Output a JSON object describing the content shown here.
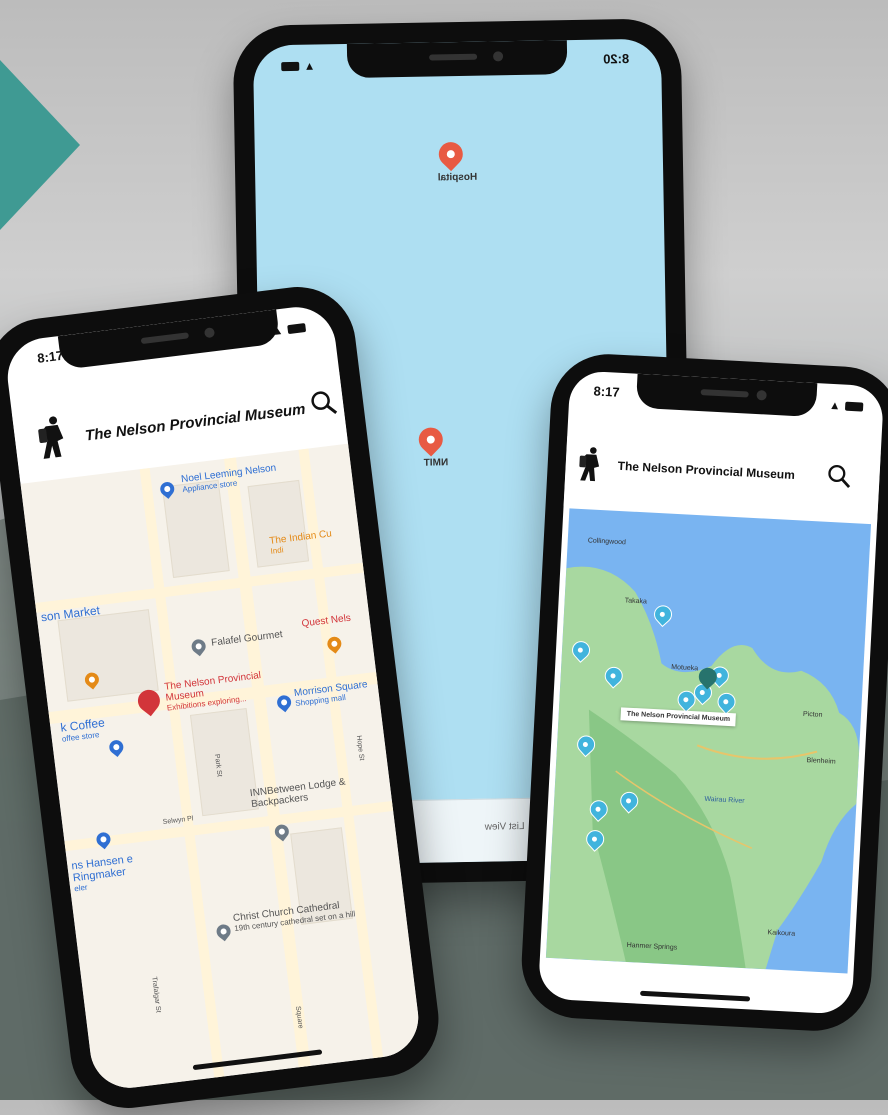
{
  "center_phone": {
    "time": "8:20",
    "pin_hospital": "Hospital",
    "pin_nmit": "NMIT",
    "tab_list": "List View"
  },
  "left_phone": {
    "time": "8:17",
    "title": "The Nelson Provincial Museum",
    "pois": {
      "noel": "Noel Leeming Nelson",
      "noel_sub": "Appliance store",
      "indian": "The Indian Cu",
      "indian_sub": "Indi",
      "market": "son Market",
      "falafel": "Falafel Gourmet",
      "quest": "Quest Nels",
      "coffee": "k Coffee",
      "coffee_sub": "offee store",
      "museum": "The Nelson Provincial Museum",
      "museum_sub": "Exhibitions exploring...",
      "morrison": "Morrison Square",
      "morrison_sub": "Shopping mall",
      "inn": "INNBetween Lodge & Backpackers",
      "hansen": "ns Hansen e Ringmaker",
      "hansen_sub": "eler",
      "cathedral": "Christ Church Cathedral",
      "cathedral_sub": "19th century cathedral set on a hill",
      "street_trafalgar": "Trafalgar St",
      "street_selwyn": "Selwyn Pl",
      "street_park": "Park St",
      "street_square": "Square",
      "street_hope": "Hope St"
    }
  },
  "right_phone": {
    "time": "8:17",
    "title": "The Nelson Provincial Museum",
    "tooltip": "The Nelson Provincial Museum",
    "places": {
      "collingwood": "Collingwood",
      "takaka": "Takaka",
      "motueka": "Motueka",
      "picton": "Picton",
      "blenheim": "Blenheim",
      "wairau": "Wairau River",
      "kaikoura": "Kaikoura",
      "hanmer": "Hanmer Springs"
    }
  },
  "colors": {
    "accent": "#3f9a93",
    "pin_red": "#e85a43",
    "sky_map": "#aedff2",
    "sea": "#79b4f1",
    "land": "#a8d8a0",
    "marker_blue": "#41b4dd"
  }
}
